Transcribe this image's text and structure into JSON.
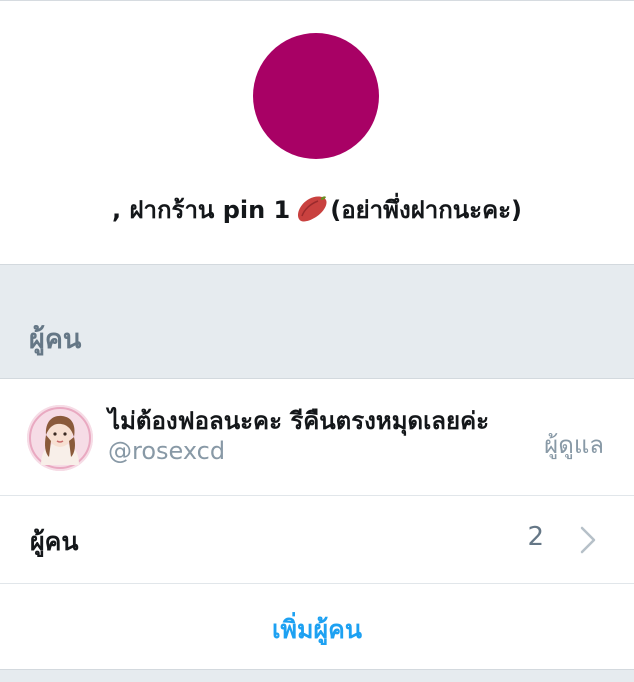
{
  "group": {
    "name_prefix": ", ฝากร้าน pin 1",
    "name_suffix": "(อย่าพึ่งฝากนะคะ)",
    "emoji_icon": "sweet-potato-icon",
    "avatar_color": "#a80165"
  },
  "section": {
    "title": "ผู้คน"
  },
  "member": {
    "display_name": "ไม่ต้องฟอลนะคะ รีคืนตรงหมุดเลยค่ะ",
    "handle": "@rosexcd",
    "role": "ผู้ดูแล"
  },
  "people": {
    "label": "ผู้คน",
    "count": "2"
  },
  "add": {
    "label": "เพิ่มผู้คน"
  },
  "colors": {
    "accent": "#1da1f2",
    "secondary_text": "#8899a6",
    "band": "#e6ebef"
  }
}
